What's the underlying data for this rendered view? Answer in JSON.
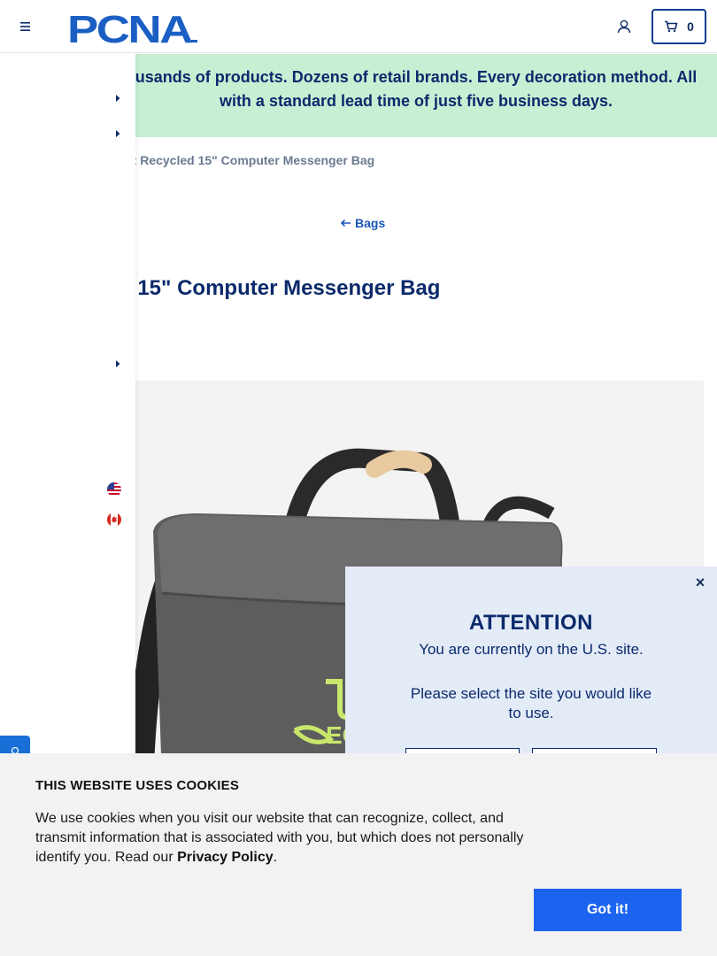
{
  "header": {
    "brand": "PCNA",
    "cart_count": "0"
  },
  "banner": {
    "text": "usands of products. Dozens of retail brands. Every decoration method. All with a standard lead time of just five business days."
  },
  "breadcrumb": {
    "current": "ft Recycled 15\" Computer Messenger Bag"
  },
  "back_link": {
    "label": "Bags"
  },
  "product": {
    "title": "d 15\" Computer Messenger Bag"
  },
  "attention": {
    "close": "×",
    "title": "ATTENTION",
    "message": "You are currently on the U.S. site.",
    "prompt": "Please select the site you would like to use."
  },
  "cookie": {
    "title": "THIS WEBSITE USES COOKIES",
    "text_before": "We use cookies when you visit our website that can recognize, collect, and transmit information that is associated with you, but which does not personally identify you. Read our ",
    "link": "Privacy Policy",
    "text_after": ".",
    "button": "Got it!"
  },
  "colors": {
    "brand_navy": "#0b2a6b",
    "banner_bg": "#c8efd4",
    "accent_blue": "#1c63f0",
    "modal_bg": "#e3ebf7",
    "cookie_bg": "#f2f2f2"
  }
}
